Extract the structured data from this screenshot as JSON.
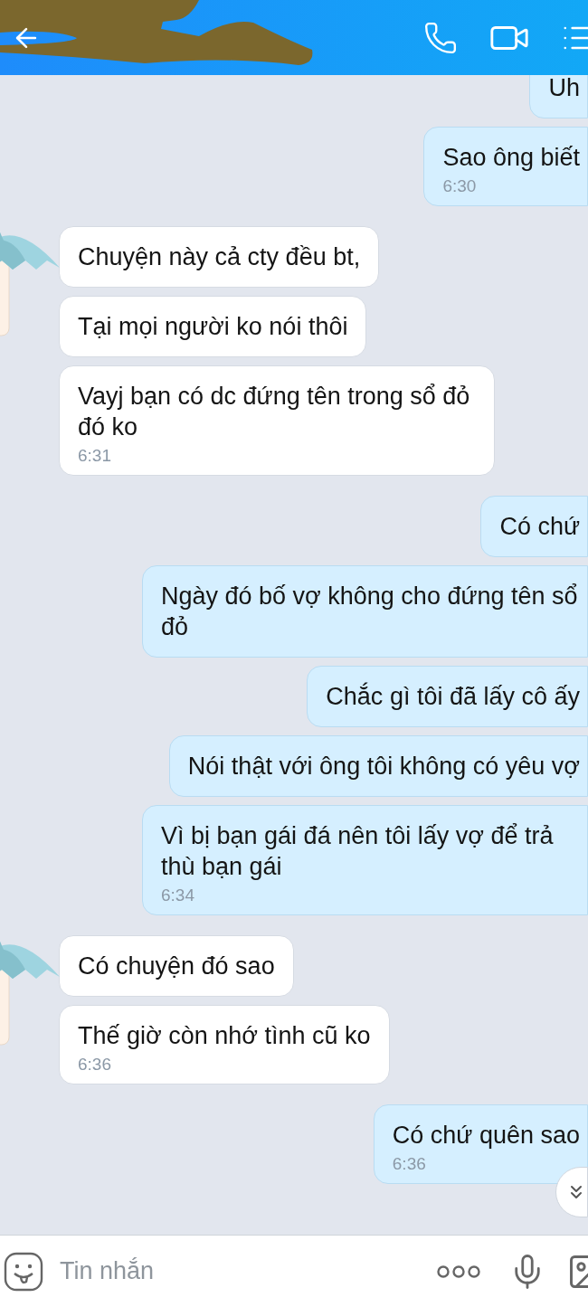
{
  "composer": {
    "placeholder": "Tin nhắn"
  },
  "messages": [
    {
      "kind": "sent",
      "text": "Uh"
    },
    {
      "kind": "sent",
      "text": "Sao ông biết",
      "time": "6:30"
    },
    {
      "kind": "received",
      "avatar": true,
      "text": "Chuyện này cả cty đều bt,"
    },
    {
      "kind": "received",
      "avatar": false,
      "text": "Tại  mọi người ko nói thôi"
    },
    {
      "kind": "received",
      "avatar": false,
      "text": "Vayj bạn có dc đứng tên trong sổ đỏ đó ko",
      "time": "6:31"
    },
    {
      "kind": "sent",
      "text": "Có chứ"
    },
    {
      "kind": "sent",
      "text": "Ngày đó bố vợ không cho đứng tên sổ đỏ"
    },
    {
      "kind": "sent",
      "text": "Chắc gì tôi đã lấy cô ấy"
    },
    {
      "kind": "sent",
      "text": "Nói thật với ông tôi không có yêu vợ"
    },
    {
      "kind": "sent",
      "text": "Vì bị bạn gái đá nên tôi lấy vợ để trả thù bạn gái",
      "time": "6:34"
    },
    {
      "kind": "received",
      "avatar": true,
      "text": "Có chuyện đó sao"
    },
    {
      "kind": "received",
      "avatar": false,
      "text": "Thế giờ còn nhớ tình cũ ko",
      "time": "6:36"
    },
    {
      "kind": "sent",
      "text": "Có chứ quên sao",
      "time": "6:36"
    }
  ]
}
